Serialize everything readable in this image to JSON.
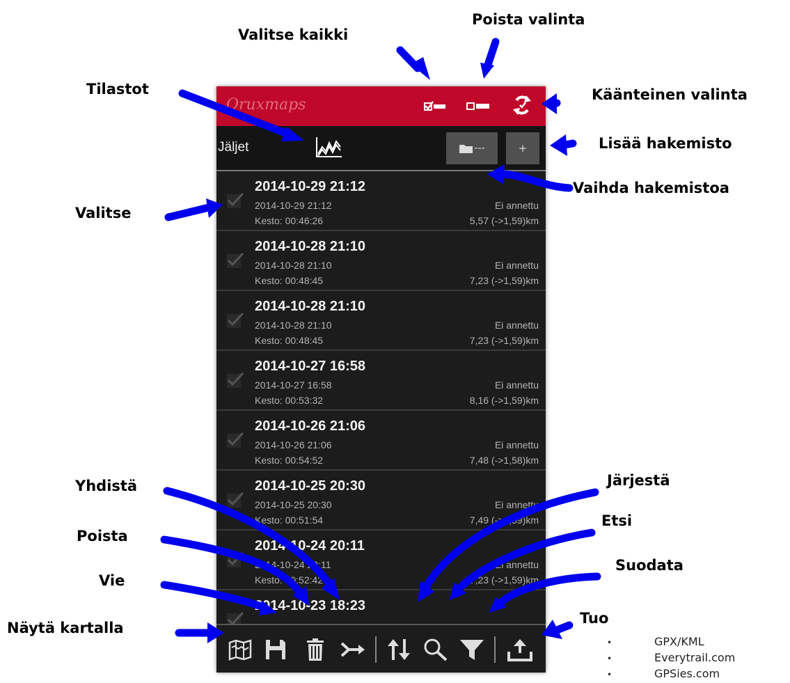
{
  "app": {
    "logo": "Oruxmaps"
  },
  "subbar": {
    "title": "Jäljet",
    "folder_label": "---",
    "add_label": "+"
  },
  "tracks": [
    {
      "title": "2014-10-29 21:12",
      "date": "2014-10-29 21:12",
      "duration": "Kesto: 00:46:26",
      "status": "Ei annettu",
      "distance": "5,57 (->1,59)km"
    },
    {
      "title": "2014-10-28 21:10",
      "date": "2014-10-28 21:10",
      "duration": "Kesto: 00:48:45",
      "status": "Ei annettu",
      "distance": "7,23 (->1,59)km"
    },
    {
      "title": "2014-10-28 21:10",
      "date": "2014-10-28 21:10",
      "duration": "Kesto: 00:48:45",
      "status": "Ei annettu",
      "distance": "7,23 (->1,59)km"
    },
    {
      "title": "2014-10-27 16:58",
      "date": "2014-10-27 16:58",
      "duration": "Kesto: 00:53:32",
      "status": "Ei annettu",
      "distance": "8,16 (->1,59)km"
    },
    {
      "title": "2014-10-26 21:06",
      "date": "2014-10-26 21:06",
      "duration": "Kesto: 00:54:52",
      "status": "Ei annettu",
      "distance": "7,48 (->1,58)km"
    },
    {
      "title": "2014-10-25 20:30",
      "date": "2014-10-25 20:30",
      "duration": "Kesto: 00:51:54",
      "status": "Ei annettu",
      "distance": "7,49 (->1,59)km"
    },
    {
      "title": "2014-10-24 20:11",
      "date": "2014-10-24 20:11",
      "duration": "Kesto: 00:52:42",
      "status": "Ei annettu",
      "distance": "7,23 (->1,59)km"
    },
    {
      "title": "2014-10-23 18:23",
      "date": "",
      "duration": "",
      "status": "",
      "distance": ""
    }
  ],
  "annotations": {
    "select_all": "Valitse kaikki",
    "deselect": "Poista valinta",
    "statistics": "Tilastot",
    "invert_selection": "Käänteinen valinta",
    "add_folder": "Lisää hakemisto",
    "change_folder": "Vaihda hakemistoa",
    "select": "Valitse",
    "merge": "Yhdistä",
    "sort": "Järjestä",
    "search": "Etsi",
    "delete": "Poista",
    "filter": "Suodata",
    "export": "Vie",
    "import": "Tuo",
    "show_on_map": "Näytä kartalla"
  },
  "import_sources": [
    "GPX/KML",
    "Everytrail.com",
    "GPSies.com"
  ],
  "import_bullet": "•",
  "colors": {
    "action_bar": "#c0082a",
    "arrow": "#0000ee",
    "background": "#1c1c1c"
  },
  "icons": {
    "actionbar": [
      "select-all-icon",
      "deselect-icon",
      "invert-selection-icon"
    ],
    "bottombar": [
      "map-icon",
      "save-icon",
      "trash-icon",
      "merge-icon",
      "sort-icon",
      "search-icon",
      "filter-icon",
      "upload-icon"
    ]
  }
}
